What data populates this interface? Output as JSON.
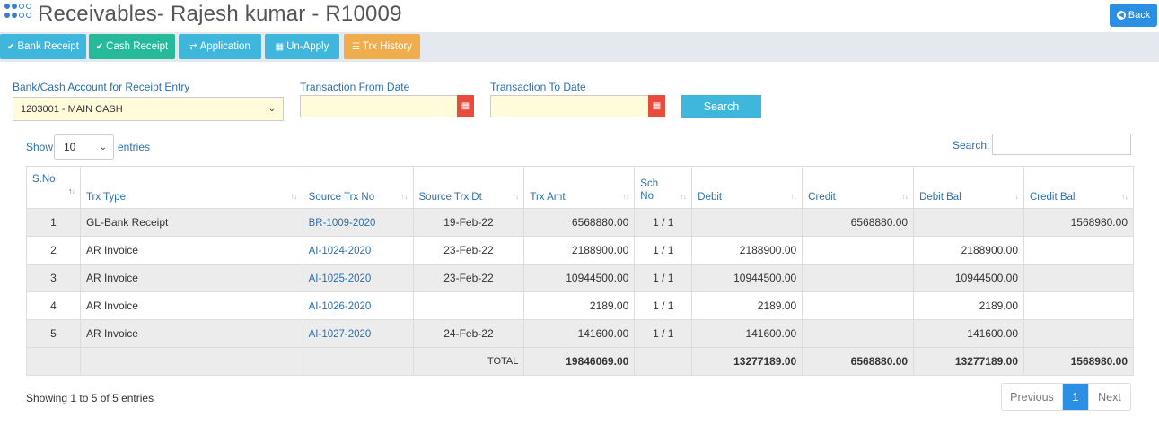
{
  "header": {
    "title": "Receivables- Rajesh kumar - R10009",
    "back_label": "Back"
  },
  "toolbar": {
    "buttons": [
      {
        "label": "Bank Receipt",
        "icon": "check-icon",
        "color": "#3fb7dd"
      },
      {
        "label": "Cash Receipt",
        "icon": "check-icon",
        "color": "#26b99a"
      },
      {
        "label": "Application",
        "icon": "exchange-icon",
        "color": "#3fb7dd"
      },
      {
        "label": "Un-Apply",
        "icon": "columns-icon",
        "color": "#3fb7dd"
      },
      {
        "label": "Trx History",
        "icon": "list-icon",
        "color": "#f0ad4e"
      }
    ]
  },
  "form": {
    "account_label": "Bank/Cash Account for Receipt Entry",
    "account_value": "1203001 - MAIN CASH",
    "from_label": "Transaction From Date",
    "from_value": "",
    "to_label": "Transaction To Date",
    "to_value": "",
    "search_label": "Search"
  },
  "datatable": {
    "show_label": "Show",
    "length_value": "10",
    "entries_label": "entries",
    "search_label": "Search:",
    "search_value": "",
    "info": "Showing 1 to 5 of 5 entries",
    "pager": {
      "prev": "Previous",
      "current": "1",
      "next": "Next"
    }
  },
  "table": {
    "columns": [
      "S.No",
      "Trx Type",
      "Source Trx No",
      "Source Trx Dt",
      "Trx Amt",
      "Sch No",
      "Debit",
      "Credit",
      "Debit Bal",
      "Credit Bal"
    ],
    "rows": [
      {
        "sno": "1",
        "type": "GL-Bank Receipt",
        "src_no": "BR-1009-2020",
        "src_dt": "19-Feb-22",
        "amt": "6568880.00",
        "sch": "1 / 1",
        "debit": "",
        "credit": "6568880.00",
        "debit_bal": "",
        "credit_bal": "1568980.00"
      },
      {
        "sno": "2",
        "type": "AR Invoice",
        "src_no": "AI-1024-2020",
        "src_dt": "23-Feb-22",
        "amt": "2188900.00",
        "sch": "1 / 1",
        "debit": "2188900.00",
        "credit": "",
        "debit_bal": "2188900.00",
        "credit_bal": ""
      },
      {
        "sno": "3",
        "type": "AR Invoice",
        "src_no": "AI-1025-2020",
        "src_dt": "23-Feb-22",
        "amt": "10944500.00",
        "sch": "1 / 1",
        "debit": "10944500.00",
        "credit": "",
        "debit_bal": "10944500.00",
        "credit_bal": ""
      },
      {
        "sno": "4",
        "type": "AR Invoice",
        "src_no": "AI-1026-2020",
        "src_dt": "",
        "amt": "2189.00",
        "sch": "1 / 1",
        "debit": "2189.00",
        "credit": "",
        "debit_bal": "2189.00",
        "credit_bal": ""
      },
      {
        "sno": "5",
        "type": "AR Invoice",
        "src_no": "AI-1027-2020",
        "src_dt": "24-Feb-22",
        "amt": "141600.00",
        "sch": "1 / 1",
        "debit": "141600.00",
        "credit": "",
        "debit_bal": "141600.00",
        "credit_bal": ""
      }
    ],
    "total": {
      "label": "TOTAL",
      "amt": "19846069.00",
      "debit": "13277189.00",
      "credit": "6568880.00",
      "debit_bal": "13277189.00",
      "credit_bal": "1568980.00"
    }
  }
}
